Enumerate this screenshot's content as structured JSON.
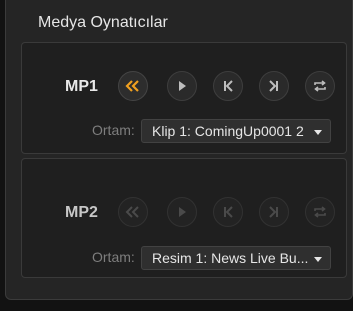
{
  "panel": {
    "title": "Medya Oynatıcılar"
  },
  "players": [
    {
      "label": "MP1",
      "active": true,
      "media_label": "Ortam:",
      "media_value": "Klip 1: ComingUp0001 2",
      "buttons": [
        "rewind-icon",
        "play-icon",
        "previous-icon",
        "next-icon",
        "loop-icon"
      ]
    },
    {
      "label": "MP2",
      "active": false,
      "media_label": "Ortam:",
      "media_value": "Resim 1: News Live Bu...",
      "buttons": [
        "rewind-icon",
        "play-icon",
        "previous-icon",
        "next-icon",
        "loop-icon"
      ]
    }
  ],
  "colors": {
    "accent": "#f0a020",
    "icon_active": "#bdbdbd",
    "icon_disabled": "#4a4a4a"
  }
}
